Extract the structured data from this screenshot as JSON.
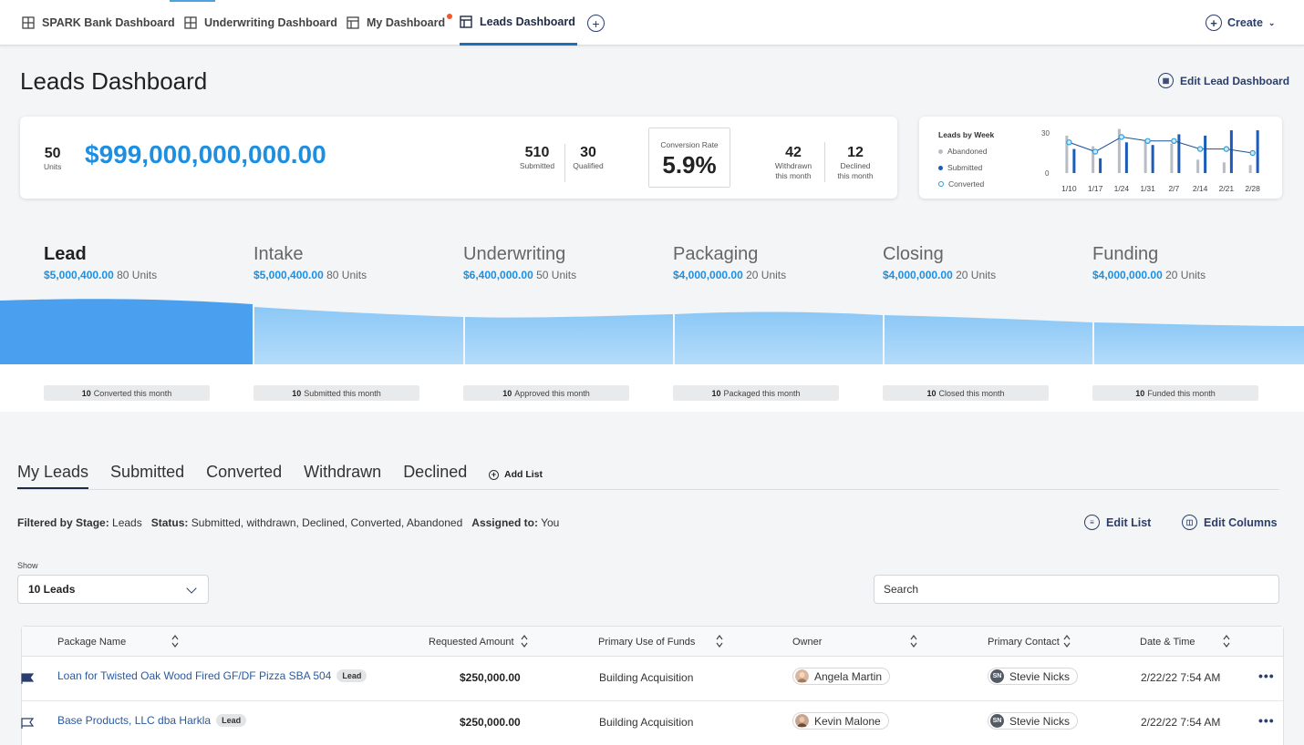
{
  "nav": {
    "tabs": [
      {
        "label": "SPARK Bank Dashboard"
      },
      {
        "label": "Underwriting Dashboard"
      },
      {
        "label": "My Dashboard"
      },
      {
        "label": "Leads Dashboard"
      }
    ],
    "create_label": "Create"
  },
  "page": {
    "title": "Leads Dashboard",
    "edit_label": "Edit Lead Dashboard"
  },
  "summary": {
    "units_value": "50",
    "units_label": "Units",
    "total_amount": "$999,000,000,000.00",
    "submitted_value": "510",
    "submitted_label": "Submitted",
    "qualified_value": "30",
    "qualified_label": "Qualified",
    "conversion_label": "Conversion Rate",
    "conversion_value": "5.9%",
    "withdrawn_value": "42",
    "withdrawn_label_1": "Withdrawn",
    "withdrawn_label_2": "this month",
    "declined_value": "12",
    "declined_label_1": "Declined",
    "declined_label_2": "this month"
  },
  "chart_data": {
    "type": "bar",
    "title": "Leads by Week",
    "categories": [
      "1/10",
      "1/17",
      "1/24",
      "1/31",
      "2/7",
      "2/14",
      "2/21",
      "2/28"
    ],
    "yticks": [
      "30",
      "0"
    ],
    "ylim": [
      0,
      30
    ],
    "series": [
      {
        "name": "Abandoned",
        "type": "bar",
        "color": "#b8bcc4",
        "values": [
          28,
          20,
          33,
          24,
          22,
          10,
          8,
          6
        ]
      },
      {
        "name": "Submitted",
        "type": "bar",
        "color": "#1c5bb8",
        "values": [
          18,
          11,
          23,
          21,
          29,
          28,
          32,
          32
        ]
      },
      {
        "name": "Converted",
        "type": "line",
        "color": "#2a9fd8",
        "values": [
          23,
          16,
          27,
          24,
          24,
          18,
          18,
          15
        ]
      }
    ],
    "legend": "left"
  },
  "stages": [
    {
      "name": "Lead",
      "amount": "$5,000,400.00",
      "units": "80 Units",
      "pill_count": "10",
      "pill_text": "Converted this month"
    },
    {
      "name": "Intake",
      "amount": "$5,000,400.00",
      "units": "80 Units",
      "pill_count": "10",
      "pill_text": "Submitted this month"
    },
    {
      "name": "Underwriting",
      "amount": "$6,400,000.00",
      "units": "50 Units",
      "pill_count": "10",
      "pill_text": "Approved this month"
    },
    {
      "name": "Packaging",
      "amount": "$4,000,000.00",
      "units": "20 Units",
      "pill_count": "10",
      "pill_text": "Packaged this month"
    },
    {
      "name": "Closing",
      "amount": "$4,000,000.00",
      "units": "20 Units",
      "pill_count": "10",
      "pill_text": "Closed this month"
    },
    {
      "name": "Funding",
      "amount": "$4,000,000.00",
      "units": "20 Units",
      "pill_count": "10",
      "pill_text": "Funded this month"
    }
  ],
  "lists": {
    "tabs": [
      "My Leads",
      "Submitted",
      "Converted",
      "Withdrawn",
      "Declined"
    ],
    "add_list_label": "Add List"
  },
  "filters": {
    "stage_label": "Filtered by Stage:",
    "stage_value": "Leads",
    "status_label": "Status:",
    "status_value": "Submitted, withdrawn, Declined, Converted, Abandoned",
    "assigned_label": "Assigned to:",
    "assigned_value": "You",
    "edit_list_label": "Edit List",
    "edit_columns_label": "Edit Columns"
  },
  "controls": {
    "show_label": "Show",
    "show_value": "10 Leads",
    "search_placeholder": "Search"
  },
  "table": {
    "columns": [
      "Package Name",
      "Requested Amount",
      "Primary Use of Funds",
      "Owner",
      "Primary Contact",
      "Date & Time"
    ],
    "rows": [
      {
        "name": "Loan for Twisted Oak Wood Fired GF/DF Pizza SBA 504",
        "badge": "Lead",
        "amount": "$250,000.00",
        "use": "Building Acquisition",
        "owner": "Angela Martin",
        "contact_initials": "SN",
        "contact": "Stevie Nicks",
        "datetime": "2/22/22 7:54 AM"
      },
      {
        "name": "Base Products, LLC dba Harkla",
        "badge": "Lead",
        "amount": "$250,000.00",
        "use": "Building Acquisition",
        "owner": "Kevin Malone",
        "contact_initials": "SN",
        "contact": "Stevie Nicks",
        "datetime": "2/22/22 7:54 AM"
      }
    ]
  }
}
